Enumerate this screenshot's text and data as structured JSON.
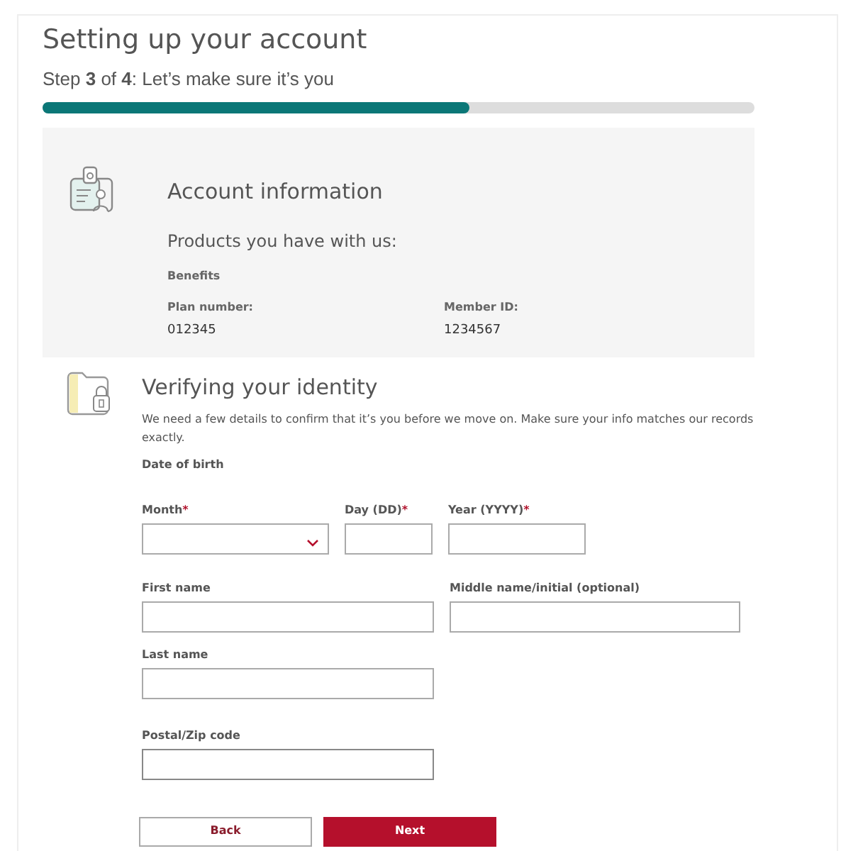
{
  "title": "Setting up your account",
  "step": "Step **3** of **4**: Let’s make sure it’s you",
  "progress": {
    "level": 0.6
  },
  "account": {
    "title": "Account information",
    "subtitle": "Products you have with us:",
    "product": "Benefits",
    "details": [
      {
        "label": "Plan number:",
        "value": "012345"
      },
      {
        "label": "Member ID:",
        "value": "1234567"
      }
    ]
  },
  "identity": {
    "title": "Verifying your identity",
    "description": "We need a few details to confirm that it’s you before we move on. Make sure your info matches our records exactly.",
    "group_label": "Date of birth",
    "fields": [
      {
        "kind": "select",
        "label": "Month",
        "mark": "*"
      },
      {
        "kind": "text",
        "label": "Day (DD)",
        "mark": "*"
      },
      {
        "kind": "text",
        "label": "Year (YYYY)",
        "mark": "*"
      },
      {
        "kind": "text",
        "label": "First name"
      },
      {
        "kind": "text",
        "label": "Middle name/initial (optional)"
      },
      {
        "kind": "text",
        "label": "Last name"
      },
      {
        "kind": "text",
        "label": "Postal/Zip code"
      }
    ]
  },
  "buttons": [
    {
      "label": "Back",
      "kind": "secondary"
    },
    {
      "label": "Next",
      "kind": "primary"
    }
  ]
}
